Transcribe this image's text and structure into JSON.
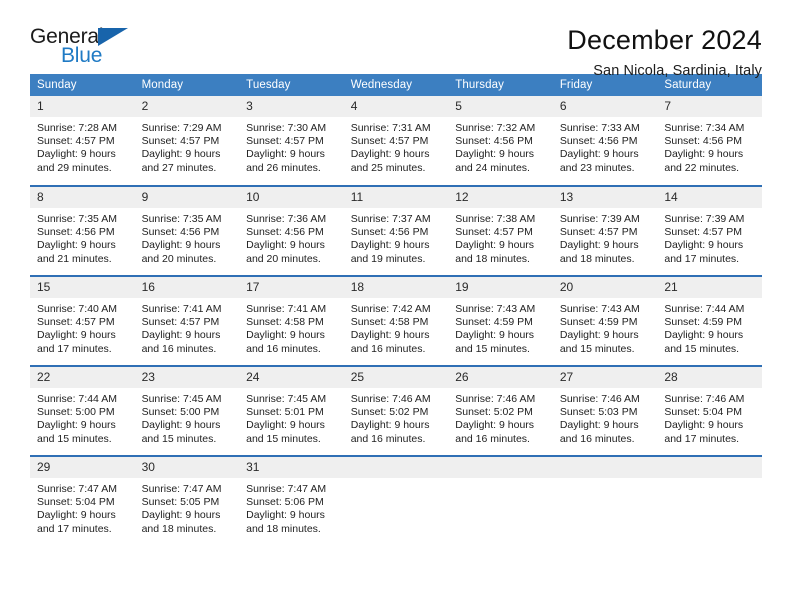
{
  "brand": {
    "name_part1": "General",
    "name_part2": "Blue"
  },
  "header": {
    "title": "December 2024",
    "location": "San Nicola, Sardinia, Italy"
  },
  "colors": {
    "header_blue": "#3c7fc1",
    "divider_blue": "#2f6fb5",
    "daynum_bg": "#efefef",
    "brand_blue": "#1f7ac4"
  },
  "weekday_headers": [
    "Sunday",
    "Monday",
    "Tuesday",
    "Wednesday",
    "Thursday",
    "Friday",
    "Saturday"
  ],
  "labels": {
    "sunrise_prefix": "Sunrise:",
    "sunset_prefix": "Sunset:",
    "daylight_prefix": "Daylight:"
  },
  "weeks": [
    [
      {
        "day": "1",
        "sunrise": "Sunrise: 7:28 AM",
        "sunset": "Sunset: 4:57 PM",
        "daylight1": "Daylight: 9 hours",
        "daylight2": "and 29 minutes."
      },
      {
        "day": "2",
        "sunrise": "Sunrise: 7:29 AM",
        "sunset": "Sunset: 4:57 PM",
        "daylight1": "Daylight: 9 hours",
        "daylight2": "and 27 minutes."
      },
      {
        "day": "3",
        "sunrise": "Sunrise: 7:30 AM",
        "sunset": "Sunset: 4:57 PM",
        "daylight1": "Daylight: 9 hours",
        "daylight2": "and 26 minutes."
      },
      {
        "day": "4",
        "sunrise": "Sunrise: 7:31 AM",
        "sunset": "Sunset: 4:57 PM",
        "daylight1": "Daylight: 9 hours",
        "daylight2": "and 25 minutes."
      },
      {
        "day": "5",
        "sunrise": "Sunrise: 7:32 AM",
        "sunset": "Sunset: 4:56 PM",
        "daylight1": "Daylight: 9 hours",
        "daylight2": "and 24 minutes."
      },
      {
        "day": "6",
        "sunrise": "Sunrise: 7:33 AM",
        "sunset": "Sunset: 4:56 PM",
        "daylight1": "Daylight: 9 hours",
        "daylight2": "and 23 minutes."
      },
      {
        "day": "7",
        "sunrise": "Sunrise: 7:34 AM",
        "sunset": "Sunset: 4:56 PM",
        "daylight1": "Daylight: 9 hours",
        "daylight2": "and 22 minutes."
      }
    ],
    [
      {
        "day": "8",
        "sunrise": "Sunrise: 7:35 AM",
        "sunset": "Sunset: 4:56 PM",
        "daylight1": "Daylight: 9 hours",
        "daylight2": "and 21 minutes."
      },
      {
        "day": "9",
        "sunrise": "Sunrise: 7:35 AM",
        "sunset": "Sunset: 4:56 PM",
        "daylight1": "Daylight: 9 hours",
        "daylight2": "and 20 minutes."
      },
      {
        "day": "10",
        "sunrise": "Sunrise: 7:36 AM",
        "sunset": "Sunset: 4:56 PM",
        "daylight1": "Daylight: 9 hours",
        "daylight2": "and 20 minutes."
      },
      {
        "day": "11",
        "sunrise": "Sunrise: 7:37 AM",
        "sunset": "Sunset: 4:56 PM",
        "daylight1": "Daylight: 9 hours",
        "daylight2": "and 19 minutes."
      },
      {
        "day": "12",
        "sunrise": "Sunrise: 7:38 AM",
        "sunset": "Sunset: 4:57 PM",
        "daylight1": "Daylight: 9 hours",
        "daylight2": "and 18 minutes."
      },
      {
        "day": "13",
        "sunrise": "Sunrise: 7:39 AM",
        "sunset": "Sunset: 4:57 PM",
        "daylight1": "Daylight: 9 hours",
        "daylight2": "and 18 minutes."
      },
      {
        "day": "14",
        "sunrise": "Sunrise: 7:39 AM",
        "sunset": "Sunset: 4:57 PM",
        "daylight1": "Daylight: 9 hours",
        "daylight2": "and 17 minutes."
      }
    ],
    [
      {
        "day": "15",
        "sunrise": "Sunrise: 7:40 AM",
        "sunset": "Sunset: 4:57 PM",
        "daylight1": "Daylight: 9 hours",
        "daylight2": "and 17 minutes."
      },
      {
        "day": "16",
        "sunrise": "Sunrise: 7:41 AM",
        "sunset": "Sunset: 4:57 PM",
        "daylight1": "Daylight: 9 hours",
        "daylight2": "and 16 minutes."
      },
      {
        "day": "17",
        "sunrise": "Sunrise: 7:41 AM",
        "sunset": "Sunset: 4:58 PM",
        "daylight1": "Daylight: 9 hours",
        "daylight2": "and 16 minutes."
      },
      {
        "day": "18",
        "sunrise": "Sunrise: 7:42 AM",
        "sunset": "Sunset: 4:58 PM",
        "daylight1": "Daylight: 9 hours",
        "daylight2": "and 16 minutes."
      },
      {
        "day": "19",
        "sunrise": "Sunrise: 7:43 AM",
        "sunset": "Sunset: 4:59 PM",
        "daylight1": "Daylight: 9 hours",
        "daylight2": "and 15 minutes."
      },
      {
        "day": "20",
        "sunrise": "Sunrise: 7:43 AM",
        "sunset": "Sunset: 4:59 PM",
        "daylight1": "Daylight: 9 hours",
        "daylight2": "and 15 minutes."
      },
      {
        "day": "21",
        "sunrise": "Sunrise: 7:44 AM",
        "sunset": "Sunset: 4:59 PM",
        "daylight1": "Daylight: 9 hours",
        "daylight2": "and 15 minutes."
      }
    ],
    [
      {
        "day": "22",
        "sunrise": "Sunrise: 7:44 AM",
        "sunset": "Sunset: 5:00 PM",
        "daylight1": "Daylight: 9 hours",
        "daylight2": "and 15 minutes."
      },
      {
        "day": "23",
        "sunrise": "Sunrise: 7:45 AM",
        "sunset": "Sunset: 5:00 PM",
        "daylight1": "Daylight: 9 hours",
        "daylight2": "and 15 minutes."
      },
      {
        "day": "24",
        "sunrise": "Sunrise: 7:45 AM",
        "sunset": "Sunset: 5:01 PM",
        "daylight1": "Daylight: 9 hours",
        "daylight2": "and 15 minutes."
      },
      {
        "day": "25",
        "sunrise": "Sunrise: 7:46 AM",
        "sunset": "Sunset: 5:02 PM",
        "daylight1": "Daylight: 9 hours",
        "daylight2": "and 16 minutes."
      },
      {
        "day": "26",
        "sunrise": "Sunrise: 7:46 AM",
        "sunset": "Sunset: 5:02 PM",
        "daylight1": "Daylight: 9 hours",
        "daylight2": "and 16 minutes."
      },
      {
        "day": "27",
        "sunrise": "Sunrise: 7:46 AM",
        "sunset": "Sunset: 5:03 PM",
        "daylight1": "Daylight: 9 hours",
        "daylight2": "and 16 minutes."
      },
      {
        "day": "28",
        "sunrise": "Sunrise: 7:46 AM",
        "sunset": "Sunset: 5:04 PM",
        "daylight1": "Daylight: 9 hours",
        "daylight2": "and 17 minutes."
      }
    ],
    [
      {
        "day": "29",
        "sunrise": "Sunrise: 7:47 AM",
        "sunset": "Sunset: 5:04 PM",
        "daylight1": "Daylight: 9 hours",
        "daylight2": "and 17 minutes."
      },
      {
        "day": "30",
        "sunrise": "Sunrise: 7:47 AM",
        "sunset": "Sunset: 5:05 PM",
        "daylight1": "Daylight: 9 hours",
        "daylight2": "and 18 minutes."
      },
      {
        "day": "31",
        "sunrise": "Sunrise: 7:47 AM",
        "sunset": "Sunset: 5:06 PM",
        "daylight1": "Daylight: 9 hours",
        "daylight2": "and 18 minutes."
      },
      {
        "day": "",
        "sunrise": "",
        "sunset": "",
        "daylight1": "",
        "daylight2": "",
        "empty": true
      },
      {
        "day": "",
        "sunrise": "",
        "sunset": "",
        "daylight1": "",
        "daylight2": "",
        "empty": true
      },
      {
        "day": "",
        "sunrise": "",
        "sunset": "",
        "daylight1": "",
        "daylight2": "",
        "empty": true
      },
      {
        "day": "",
        "sunrise": "",
        "sunset": "",
        "daylight1": "",
        "daylight2": "",
        "empty": true
      }
    ]
  ]
}
